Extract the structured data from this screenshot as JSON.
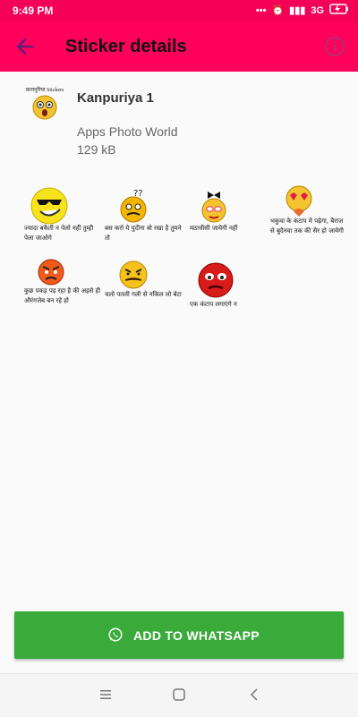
{
  "status_bar": {
    "time": "9:49 PM",
    "network": "3G"
  },
  "app_bar": {
    "title": "Sticker details",
    "back_icon": "arrow-back-icon",
    "info_icon": "info-icon"
  },
  "pack": {
    "icon_caption": "कानपुरिया Stickers",
    "name": "Kanpuriya 1",
    "publisher": "Apps Photo World",
    "size": "129 kB"
  },
  "stickers": [
    {
      "caption": "ज्यादा बकैती न पेलो नहीं तुम्ही पेला जाओगे"
    },
    {
      "caption": "बस करो ये पुदीना बो रखा है तुमने तो"
    },
    {
      "caption": "मठाधीसी जायेगी नहीं"
    },
    {
      "caption": "भकुवा के कंटाप मे पढ़ेगा, बैराज से बुदैनवा तक की सैर हो जायेगी"
    },
    {
      "caption": "कुछ पकड़ पड़ रहा है की अइसे ही औरंगजेब बन रहे हो"
    },
    {
      "caption": "चलो पतली गली से नकिल लो बेटा"
    },
    {
      "caption": "एक कंटाप लगाएंगे न"
    }
  ],
  "add_button": {
    "label": "ADD TO WHATSAPP"
  },
  "colors": {
    "accent": "#ff005a",
    "button": "#3aab3a"
  }
}
